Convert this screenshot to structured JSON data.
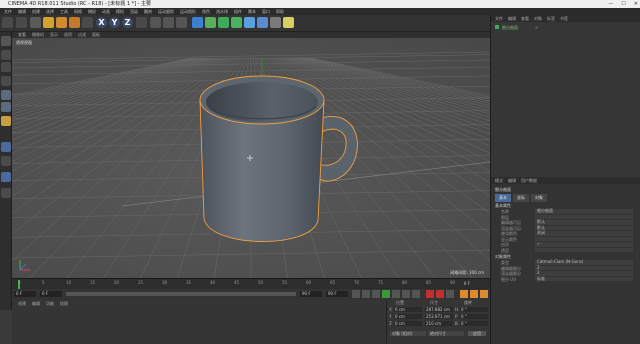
{
  "window": {
    "title": "CINEMA 4D R18.011 Studio (RC - R18) - [未标题 1 *] - 主要",
    "controls": [
      "—",
      "☐",
      "✕"
    ]
  },
  "menubar": [
    "文件",
    "编辑",
    "创建",
    "选择",
    "工具",
    "网格",
    "捕捉",
    "动画",
    "模拟",
    "渲染",
    "雕刻",
    "运动跟踪",
    "运动图形",
    "角色",
    "流水线",
    "插件",
    "脚本",
    "窗口",
    "帮助"
  ],
  "toolbar": {
    "x": "X",
    "y": "Y",
    "z": "Z"
  },
  "viewport": {
    "menu": [
      "查看",
      "摄像机",
      "显示",
      "选项",
      "过滤",
      "面板"
    ],
    "label": "透视视图",
    "grid_info": "网格间距: 100 cm"
  },
  "timeline": {
    "ticks": [
      "0",
      "5",
      "10",
      "15",
      "20",
      "25",
      "30",
      "35",
      "40",
      "45",
      "50",
      "55",
      "60",
      "65",
      "70",
      "75",
      "80",
      "85",
      "90"
    ],
    "end_frame": "0 F"
  },
  "playbar": {
    "current": "0 F",
    "start": "0 F",
    "end": "90 F",
    "max": "90 F"
  },
  "materials": {
    "menu": [
      "创建",
      "编辑",
      "功能",
      "纹理"
    ]
  },
  "coordinates": {
    "headers": [
      "位置",
      "尺寸",
      "旋转"
    ],
    "rows": [
      {
        "axis": "X",
        "pos": "0 cm",
        "size": "287.882 cm",
        "rlabel": "H",
        "rot": "0 °"
      },
      {
        "axis": "Y",
        "pos": "0 cm",
        "size": "253.971 cm",
        "rlabel": "P",
        "rot": "0 °"
      },
      {
        "axis": "Z",
        "pos": "0 cm",
        "size": "210 cm",
        "rlabel": "B",
        "rot": "0 °"
      }
    ],
    "mode": "对象 (相对)",
    "size_mode": "绝对尺寸",
    "apply": "应用"
  },
  "objects": {
    "tabs": [
      "文件",
      "编辑",
      "查看",
      "对象",
      "标签",
      "书签"
    ],
    "item": "细分曲面"
  },
  "attributes": {
    "tabs": [
      "模式",
      "编辑",
      "用户数据"
    ],
    "sections": [
      "基本",
      "坐标",
      "对象"
    ],
    "heading": "细分曲面",
    "basic_title": "基本属性",
    "rows": [
      {
        "label": "名称",
        "value": "细分曲面"
      },
      {
        "label": "图层",
        "value": ""
      },
      {
        "label": "编辑器可见",
        "value": "默认"
      },
      {
        "label": "渲染器可见",
        "value": "默认"
      },
      {
        "label": "使用颜色",
        "value": "关闭"
      },
      {
        "label": "显示颜色",
        "value": ""
      },
      {
        "label": "启用",
        "value": "✓"
      },
      {
        "label": "透显",
        "value": ""
      }
    ],
    "obj_title": "对象属性",
    "obj_rows": [
      {
        "label": "类型",
        "value": "Catmull-Clark (N-Gons)"
      },
      {
        "label": "编辑器细分",
        "value": "2"
      },
      {
        "label": "渲染器细分",
        "value": "2"
      },
      {
        "label": "细分 UV",
        "value": "标准"
      }
    ]
  },
  "colors": {
    "accent": "#f0a040",
    "mug": "#5f6770",
    "grid_bg": "#525252"
  }
}
